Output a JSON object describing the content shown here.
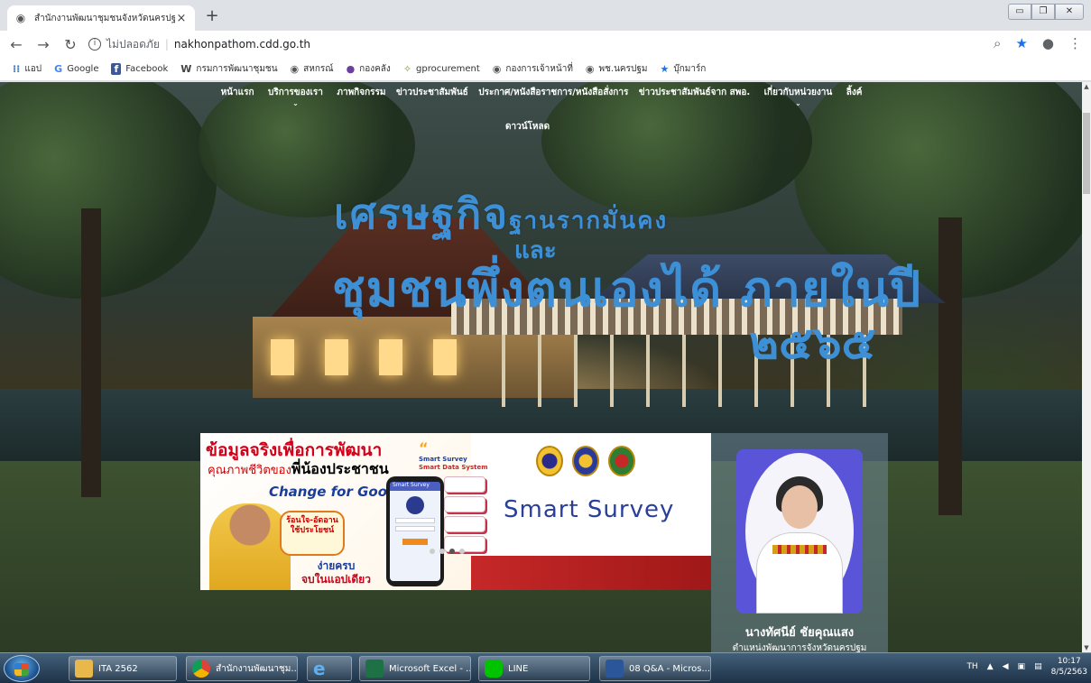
{
  "browser": {
    "tab_title": "สำนักงานพัฒนาชุมชนจังหวัดนครปฐม",
    "tab_close": "×",
    "new_tab": "+",
    "security_label": "ไม่ปลอดภัย",
    "url": "nakhonpathom.cdd.go.th",
    "bookmarks": [
      {
        "icon": "apps-icon",
        "label": "แอป"
      },
      {
        "icon": "google-icon",
        "label": "Google"
      },
      {
        "icon": "facebook-icon",
        "label": "Facebook"
      },
      {
        "icon": "cdd-icon",
        "label": "กรมการพัฒนาชุมชน"
      },
      {
        "icon": "globe-icon",
        "label": "สหกรณ์"
      },
      {
        "icon": "circle-icon",
        "label": "กองคลัง"
      },
      {
        "icon": "gprocurement-icon",
        "label": "gprocurement"
      },
      {
        "icon": "globe-icon",
        "label": "กองการเจ้าหน้าที่"
      },
      {
        "icon": "globe-icon",
        "label": "พช.นครปฐม"
      },
      {
        "icon": "star-icon",
        "label": "บุ๊กมาร์ก"
      }
    ]
  },
  "site": {
    "nav": [
      "หน้าแรก",
      "บริการของเรา",
      "ภาพกิจกรรม",
      "ข่าวประชาสัมพันธ์",
      "ประกาศ/หนังสือราชการ/หนังสือสั่งการ",
      "ข่าวประชาสัมพันธ์จาก สพอ.",
      "เกี่ยวกับหน่วยงาน",
      "ลิ้งค์"
    ],
    "nav_second": "ดาวน์โหลด",
    "headline": {
      "line1_big": "เศรษฐกิจ",
      "line1_small": "ฐานรากมั่นคง",
      "line2": "และ",
      "line3": "ชุมชนพึ่งตนเองได้ ภายในปี",
      "line4": "๒๕๖๕"
    },
    "banner": {
      "title": "ข้อมูลจริงเพื่อการพัฒนา",
      "subtitle_prefix": "คุณภาพชีวิตของ",
      "subtitle_bold": "พี่น้องประชาชน",
      "slogan": "Change for Good",
      "bubble": "ร้อนใจ-อัดอาน ใช้ประโยชน์",
      "easy_line1": "ง่ายครบ",
      "easy_line2": "จบในแอปเดียว",
      "app_name_1": "Smart Survey",
      "app_name_2": "Smart Data System",
      "brand": "Smart Survey",
      "phone_header": "Smart Survey"
    },
    "official": {
      "name": "นางทัศนีย์ ชัยคุณแสง",
      "position": "ตำแหน่งพัฒนาการจังหวัดนครปฐม"
    }
  },
  "taskbar": {
    "items": [
      {
        "icon": "folder-icon",
        "label": "ITA 2562",
        "color": "#e8b84a"
      },
      {
        "icon": "chrome-icon",
        "label": "สำนักงานพัฒนาชุม...",
        "color": "#dd4b39"
      },
      {
        "icon": "ie-icon",
        "label": "",
        "color": "#2a7fd6"
      },
      {
        "icon": "excel-icon",
        "label": "Microsoft Excel - ...",
        "color": "#1e7145"
      },
      {
        "icon": "line-icon",
        "label": "LINE",
        "color": "#00c300"
      },
      {
        "icon": "word-icon",
        "label": "08 Q&A - Micros...",
        "color": "#2b579a"
      }
    ],
    "lang": "TH",
    "time": "10:17",
    "date": "8/5/2563"
  }
}
